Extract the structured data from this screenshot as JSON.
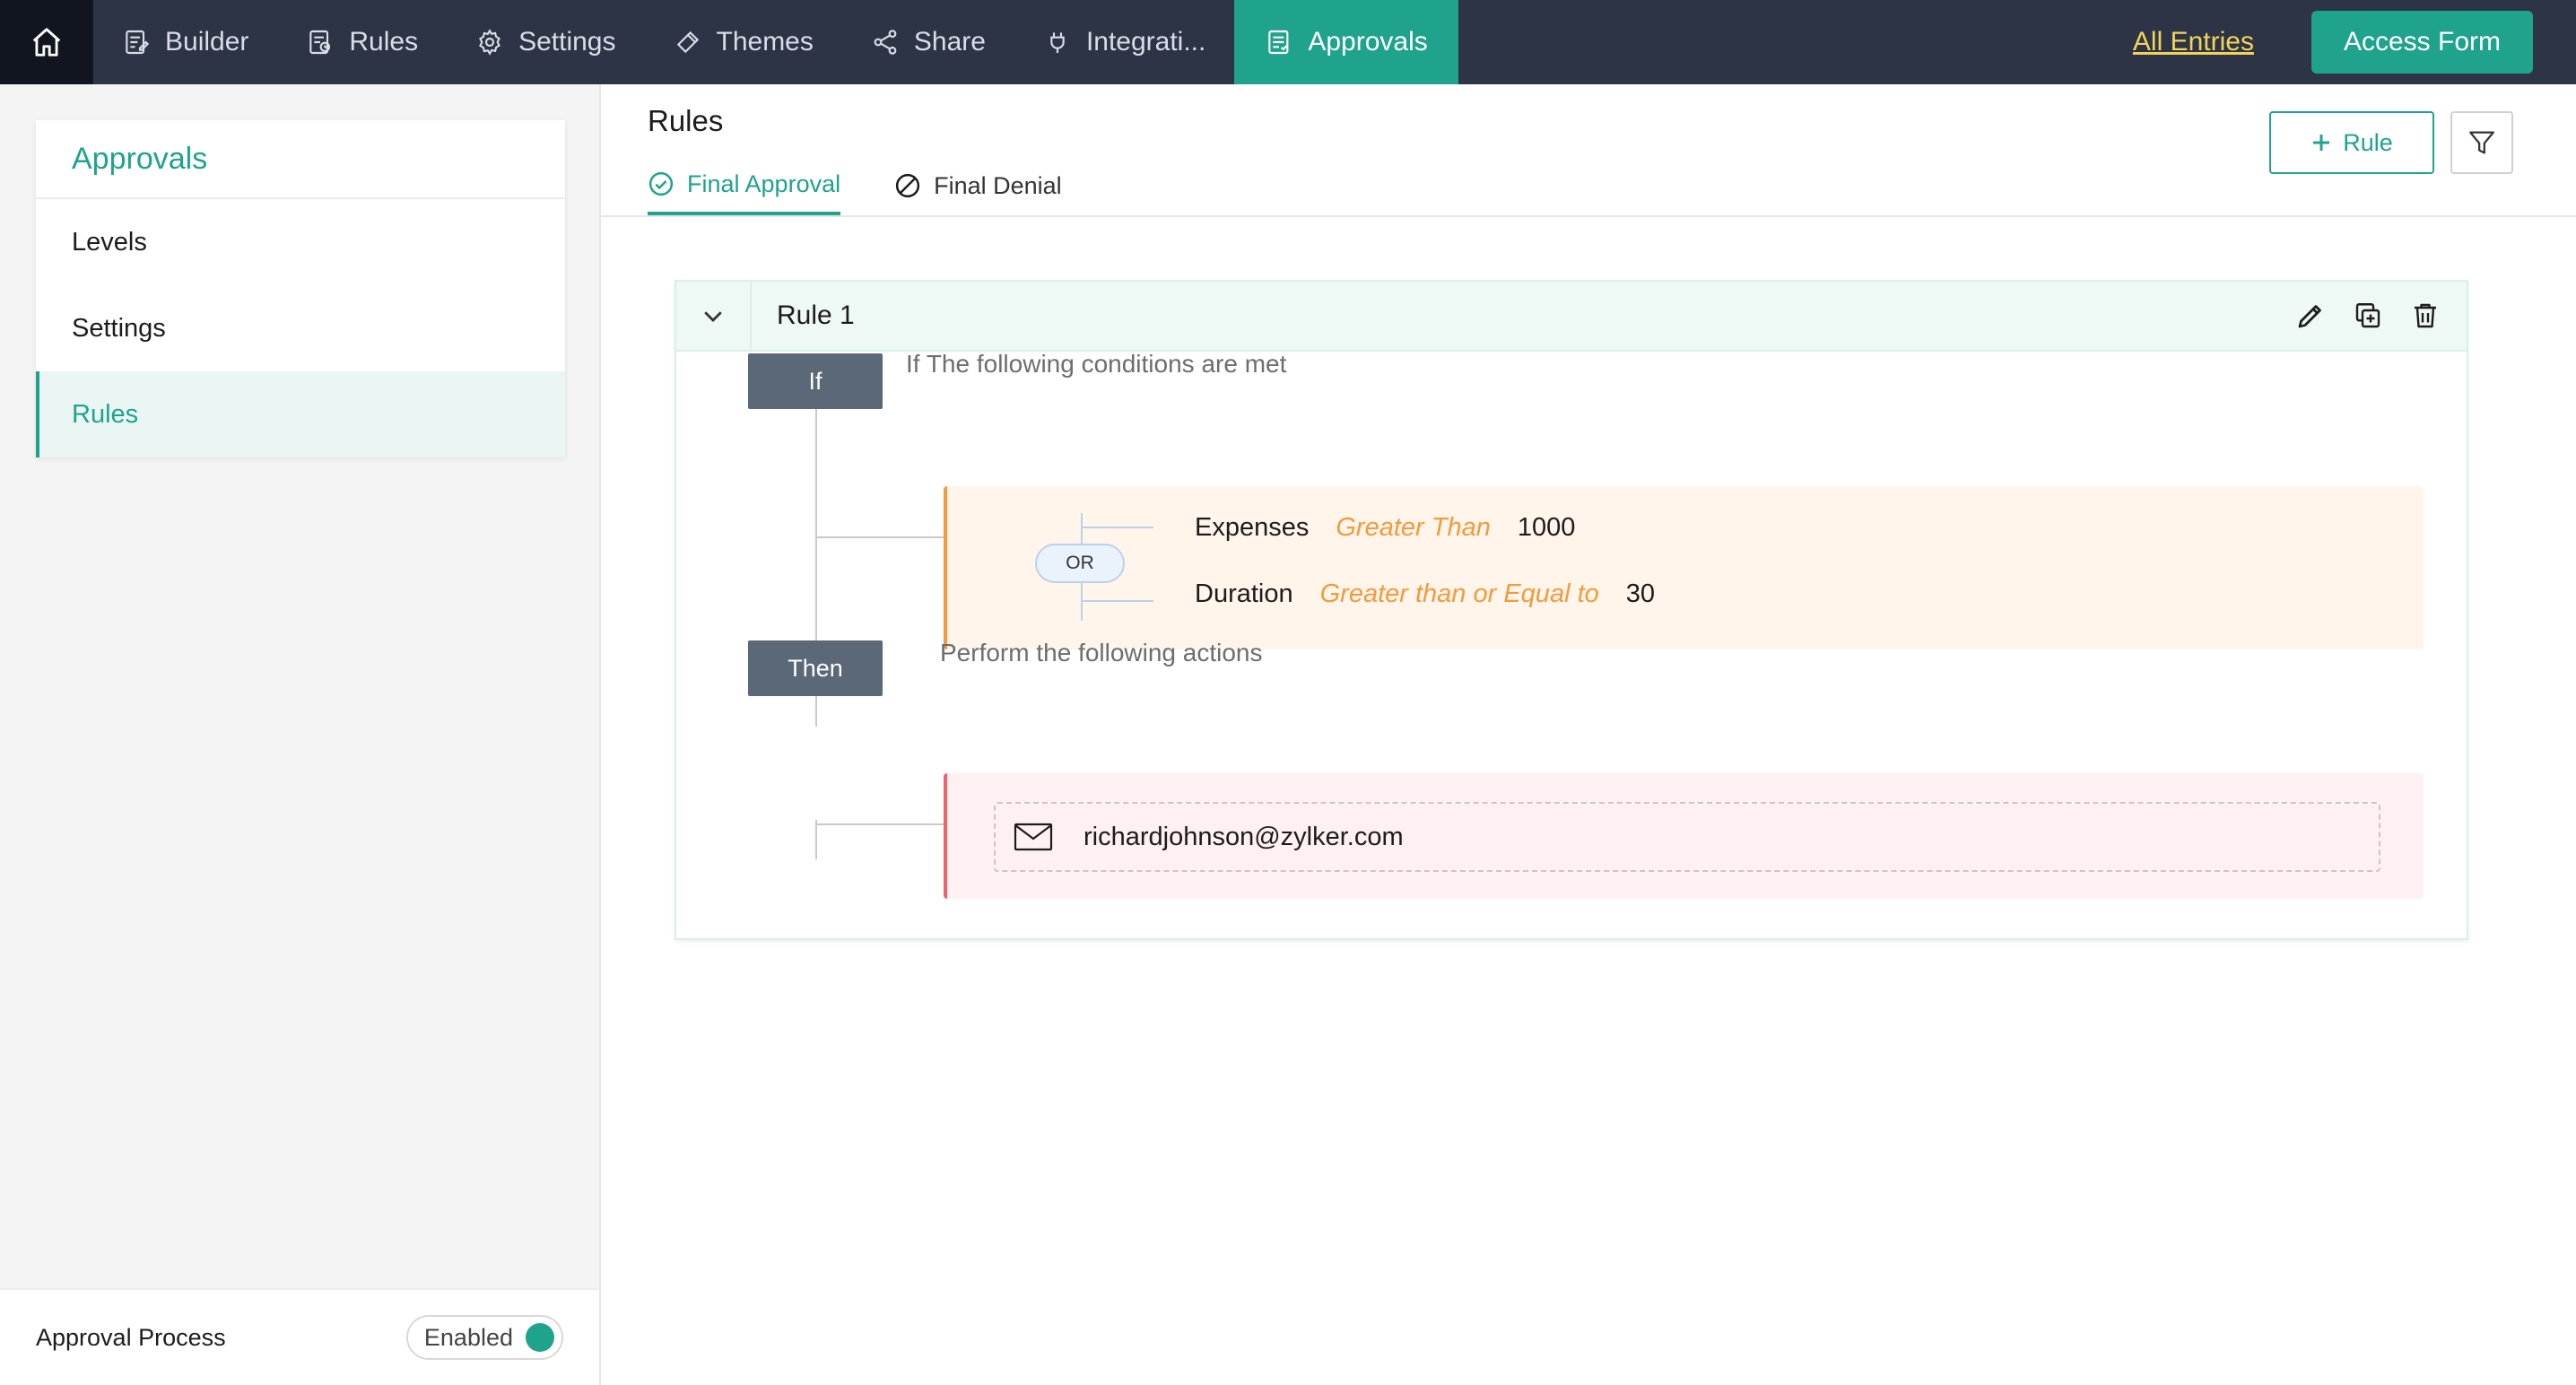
{
  "nav": {
    "items": [
      {
        "label": "Builder",
        "icon": "builder-icon"
      },
      {
        "label": "Rules",
        "icon": "rules-icon"
      },
      {
        "label": "Settings",
        "icon": "gear-icon"
      },
      {
        "label": "Themes",
        "icon": "brush-icon"
      },
      {
        "label": "Share",
        "icon": "share-icon"
      },
      {
        "label": "Integrati...",
        "icon": "plug-icon"
      },
      {
        "label": "Approvals",
        "icon": "approvals-icon"
      }
    ],
    "active": "Approvals",
    "all_entries": "All Entries",
    "access_form": "Access Form"
  },
  "sidebar": {
    "title": "Approvals",
    "items": [
      {
        "label": "Levels"
      },
      {
        "label": "Settings"
      },
      {
        "label": "Rules"
      }
    ],
    "active": "Rules",
    "footer": {
      "label": "Approval Process",
      "toggle_label": "Enabled",
      "toggle_on": true
    }
  },
  "main": {
    "title": "Rules",
    "tabs": [
      {
        "label": "Final Approval",
        "icon": "check-circle-icon"
      },
      {
        "label": "Final Denial",
        "icon": "denial-icon"
      }
    ],
    "active_tab": "Final Approval",
    "add_rule_label": "Rule"
  },
  "rule": {
    "name": "Rule 1",
    "if_label": "If",
    "if_caption": "If The following conditions are met",
    "connector": "OR",
    "conditions": [
      {
        "field": "Expenses",
        "operator": "Greater Than",
        "value": "1000"
      },
      {
        "field": "Duration",
        "operator": "Greater than or Equal to",
        "value": "30"
      }
    ],
    "then_label": "Then",
    "then_caption": "Perform the following actions",
    "action_email": "richardjohnson@zylker.com"
  },
  "colors": {
    "topbar": "#2d3446",
    "accent": "#1fa38c",
    "link": "#f3d45a",
    "condition_accent": "#f39a3d",
    "action_accent": "#f0616a",
    "pill": "#5b6878"
  }
}
